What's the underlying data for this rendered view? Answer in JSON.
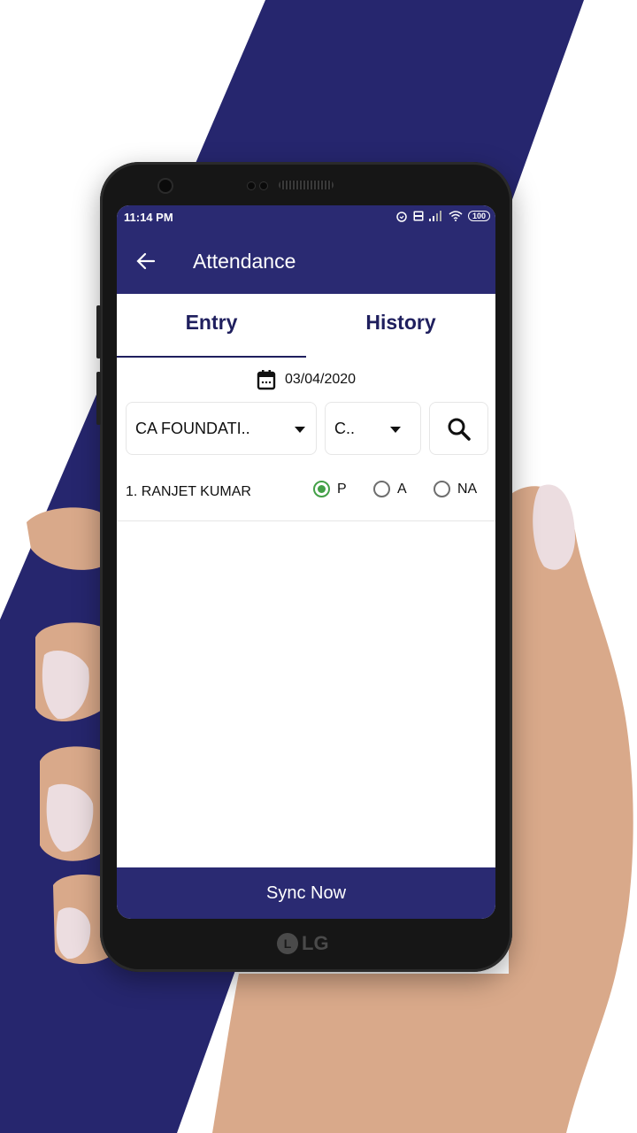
{
  "colors": {
    "brand": "#2a2a72",
    "tab_text": "#1f1f5e",
    "radio_checked": "#43a047",
    "radio_unchecked": "#6e6e6e"
  },
  "status_bar": {
    "time": "11:14 PM",
    "battery": "100",
    "icons": [
      "alarm-icon",
      "volte-icon",
      "signal-icon",
      "wifi-icon",
      "battery-icon"
    ]
  },
  "app_bar": {
    "back_icon": "arrow-left-icon",
    "title": "Attendance"
  },
  "tabs": [
    {
      "label": "Entry",
      "selected": true
    },
    {
      "label": "History",
      "selected": false
    }
  ],
  "date_picker": {
    "icon": "calendar-icon",
    "value": "03/04/2020"
  },
  "filters": {
    "course": {
      "selected": "CA FOUNDATI.."
    },
    "batch": {
      "selected": "C.."
    },
    "search_icon": "search-icon"
  },
  "students": [
    {
      "label": "1. RANJET KUMAR",
      "options": [
        {
          "label": "P",
          "checked": true
        },
        {
          "label": "A",
          "checked": false
        },
        {
          "label": "NA",
          "checked": false
        }
      ]
    }
  ],
  "footer": {
    "sync_label": "Sync Now"
  },
  "device": {
    "brand_label": "LG"
  }
}
